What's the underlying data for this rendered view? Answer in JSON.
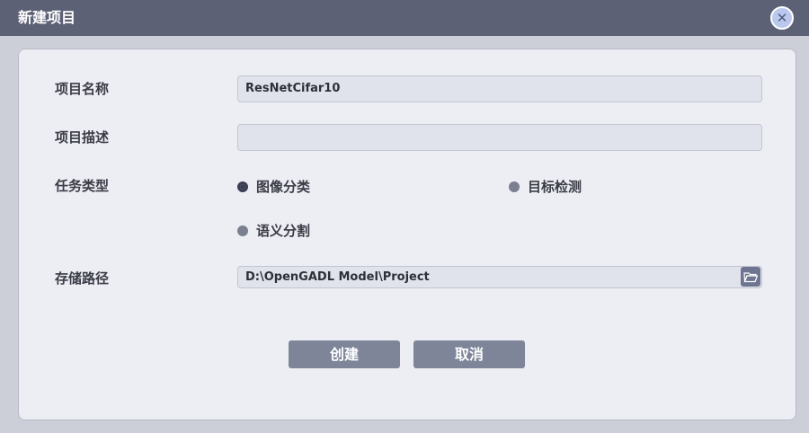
{
  "window": {
    "title": "新建项目",
    "close_symbol": "✕"
  },
  "form": {
    "name_label": "项目名称",
    "name_value": "ResNetCifar10",
    "desc_label": "项目描述",
    "desc_value": "",
    "task_label": "任务类型",
    "task_options": [
      {
        "label": "图像分类",
        "selected": true
      },
      {
        "label": "目标检测",
        "selected": false
      },
      {
        "label": "语义分割",
        "selected": false
      }
    ],
    "path_label": "存储路径",
    "path_value": "D:\\OpenGADL Model\\Project",
    "folder_icon": "folder-open-icon"
  },
  "buttons": {
    "create": "创建",
    "cancel": "取消"
  },
  "colors": {
    "titlebar": "#5d6175",
    "panel": "#edeef4",
    "button": "#7e8598"
  }
}
